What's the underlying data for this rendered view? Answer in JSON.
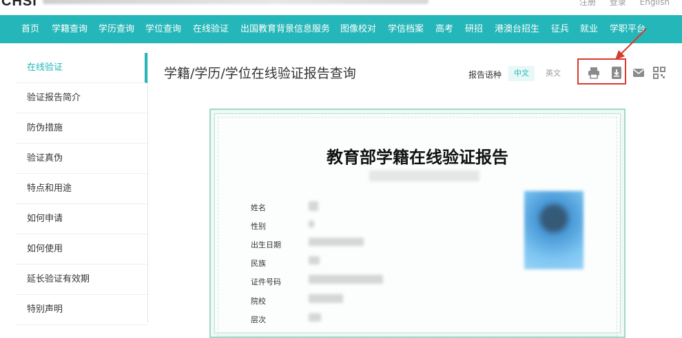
{
  "top": {
    "logo": "CHSI",
    "links": [
      "注册",
      "登录",
      "English"
    ]
  },
  "nav": {
    "items": [
      "首页",
      "学籍查询",
      "学历查询",
      "学位查询",
      "在线验证",
      "出国教育背景信息服务",
      "图像校对",
      "学信档案",
      "高考",
      "研招",
      "港澳台招生",
      "征兵",
      "就业",
      "学职平台"
    ]
  },
  "sidebar": {
    "items": [
      "在线验证",
      "验证报告简介",
      "防伪措施",
      "验证真伪",
      "特点和用途",
      "如何申请",
      "如何使用",
      "延长验证有效期",
      "特别声明"
    ]
  },
  "main": {
    "title": "学籍/学历/学位在线验证报告查询",
    "lang_label": "报告语种",
    "lang_cn": "中文",
    "lang_en": "英文"
  },
  "report": {
    "title": "教育部学籍在线验证报告",
    "fields": [
      "姓名",
      "性别",
      "出生日期",
      "民族",
      "证件号码",
      "院校",
      "层次"
    ]
  },
  "icons": [
    "print-icon",
    "download-icon",
    "mail-icon",
    "qrcode-icon"
  ],
  "colors": {
    "accent": "#24b6b8",
    "highlight": "#d83a2e"
  }
}
